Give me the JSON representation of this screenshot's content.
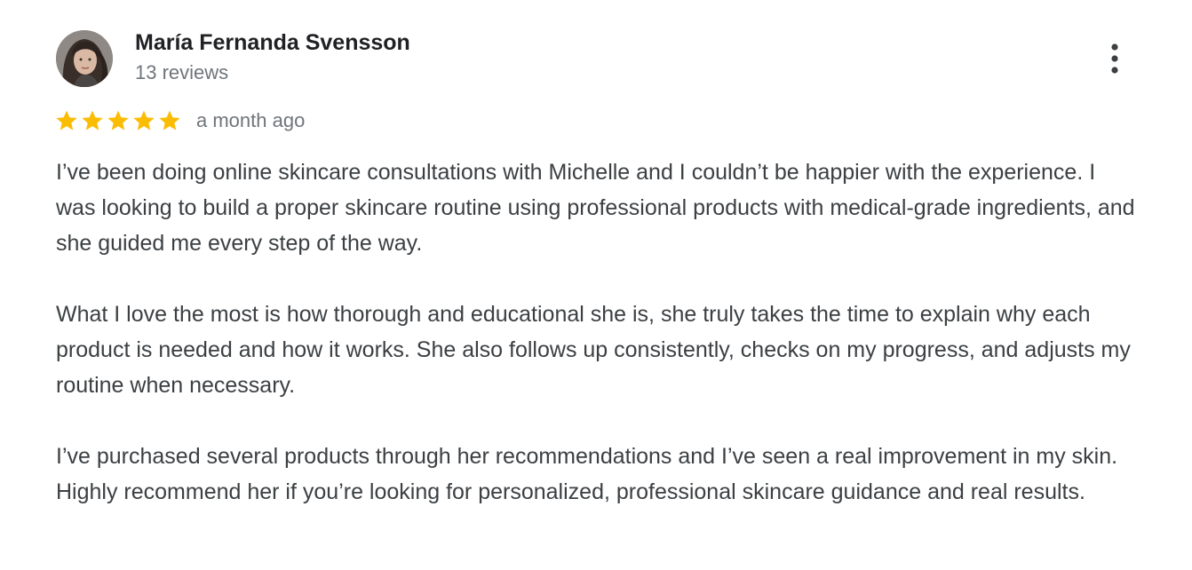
{
  "review": {
    "author": {
      "name": "María Fernanda Svensson",
      "review_count": "13 reviews",
      "avatar_icon": "profile-photo"
    },
    "rating": {
      "stars": 5,
      "max_stars": 5,
      "star_color": "#fbbc04",
      "date": "a month ago"
    },
    "body": {
      "paragraphs": [
        "I’ve been doing online skincare consultations with Michelle and I couldn’t be happier with the experience. I was looking to build a proper skincare routine using professional products with medical-grade ingredients, and she guided me every step of the way.",
        "What I love the most is how thorough and educational she is, she truly takes the time to explain why each product is needed and how it works. She also follows up consistently, checks on my progress, and adjusts my routine when necessary.",
        "I’ve purchased several products through her recommendations and I’ve seen a real improvement in my skin. Highly recommend her if you’re looking for personalized, professional skincare guidance and real results."
      ]
    },
    "actions": {
      "more_icon": "more-vertical-icon"
    }
  }
}
